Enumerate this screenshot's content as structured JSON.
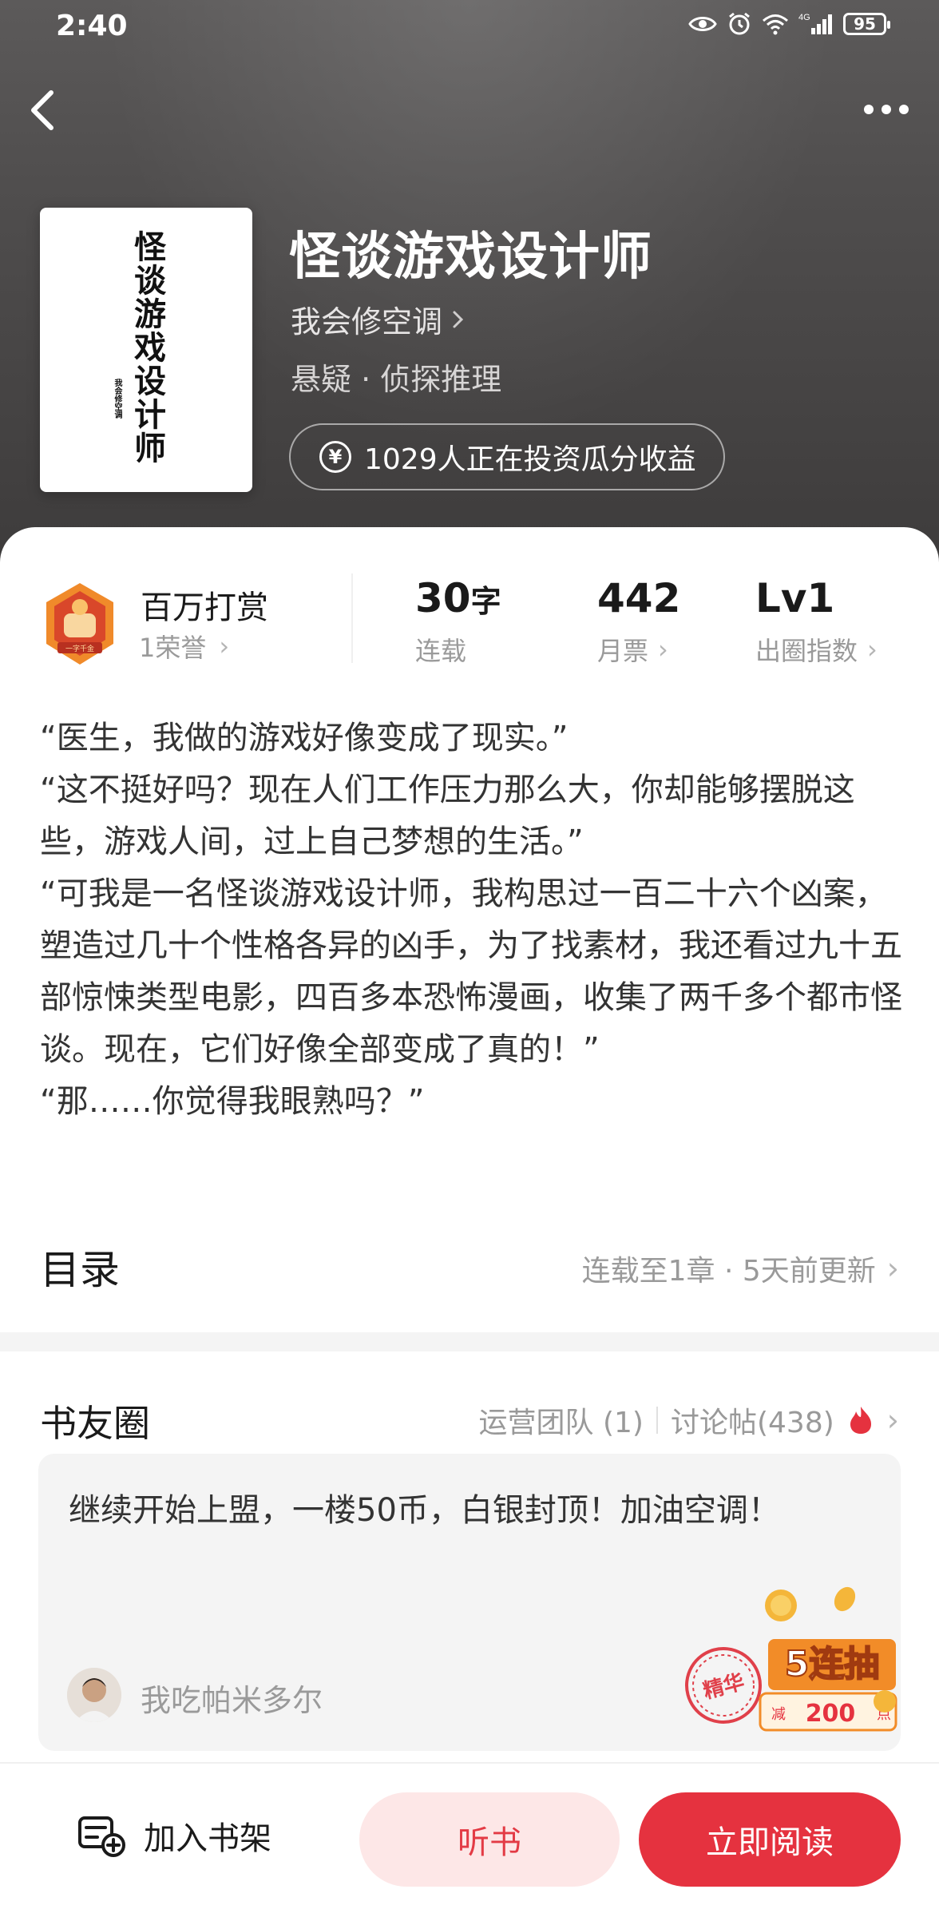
{
  "status_bar": {
    "time": "2:40",
    "network": "4G",
    "battery": "95",
    "icons": [
      "eye-icon",
      "alarm-icon",
      "wifi-icon",
      "signal-icon",
      "battery-icon"
    ]
  },
  "nav": {
    "back_icon": "chevron-left-icon",
    "more_icon": "more-dots-icon"
  },
  "cover": {
    "title": "怪谈游戏设计师",
    "author": "我会修空调"
  },
  "book": {
    "title": "怪谈游戏设计师",
    "author": "我会修空调",
    "tags": "悬疑 · 侦探推理",
    "invest_text": "1029人正在投资瓜分收益",
    "invest_icon": "yen-coin-icon"
  },
  "stats": {
    "reward_title": "百万打赏",
    "reward_sub": "1荣誉",
    "reward_badge_text": "一字千金",
    "word_count_value": "30",
    "word_count_unit": "字",
    "word_count_label": "连载",
    "monthly_ticket_value": "442",
    "monthly_ticket_label": "月票",
    "popularity_value": "Lv1",
    "popularity_label": "出圈指数"
  },
  "synopsis": [
    "“医生，我做的游戏好像变成了现实。”",
    "“这不挺好吗？现在人们工作压力那么大，你却能够摆脱这些，游戏人间，过上自己梦想的生活。”",
    "“可我是一名怪谈游戏设计师，我构思过一百二十六个凶案，塑造过几十个性格各异的凶手，为了找素材，我还看过九十五部惊悚类型电影，四百多本恐怖漫画，收集了两千多个都市怪谈。现在，它们好像全部变成了真的！”",
    "“那……你觉得我眼熟吗？”"
  ],
  "toc": {
    "title": "目录",
    "meta": "连载至1章 · 5天前更新"
  },
  "circle": {
    "title": "书友圈",
    "team": "运营团队 (1)",
    "posts": "讨论帖(438)",
    "hot_icon": "flame-icon"
  },
  "post": {
    "text": "继续开始上盟，一楼50币，白银封顶！加油空调！",
    "poster_name": "我吃帕米多尔",
    "stamp_text": "精华",
    "promo_title": "5连抽",
    "promo_reduce": "减",
    "promo_amount": "200",
    "promo_unit": "点"
  },
  "bottom": {
    "shelf_label": "加入书架",
    "listen_label": "听书",
    "read_label": "立即阅读"
  },
  "colors": {
    "accent_red": "#e5323f",
    "listen_bg": "#fde7e7",
    "header_bg": "#4f4d4d"
  }
}
